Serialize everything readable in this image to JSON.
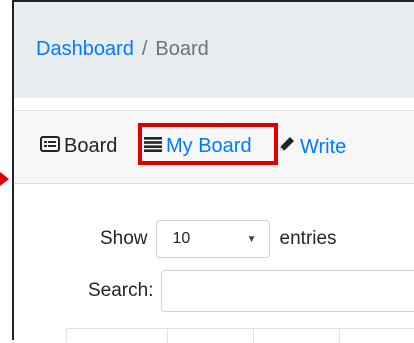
{
  "breadcrumb": {
    "home": "Dashboard",
    "separator": "/",
    "current": "Board"
  },
  "tabs": [
    {
      "label": "Board",
      "icon": "list-alt-icon"
    },
    {
      "label": "My Board",
      "icon": "list-icon"
    },
    {
      "label": "Write",
      "icon": "pencil-icon"
    }
  ],
  "length": {
    "prefix": "Show",
    "selected": "10",
    "suffix": "entries"
  },
  "search": {
    "label": "Search:",
    "value": ""
  },
  "colors": {
    "link": "#007bff",
    "highlight": "#e00000",
    "breadcrumb_bg": "#e9ecef"
  }
}
